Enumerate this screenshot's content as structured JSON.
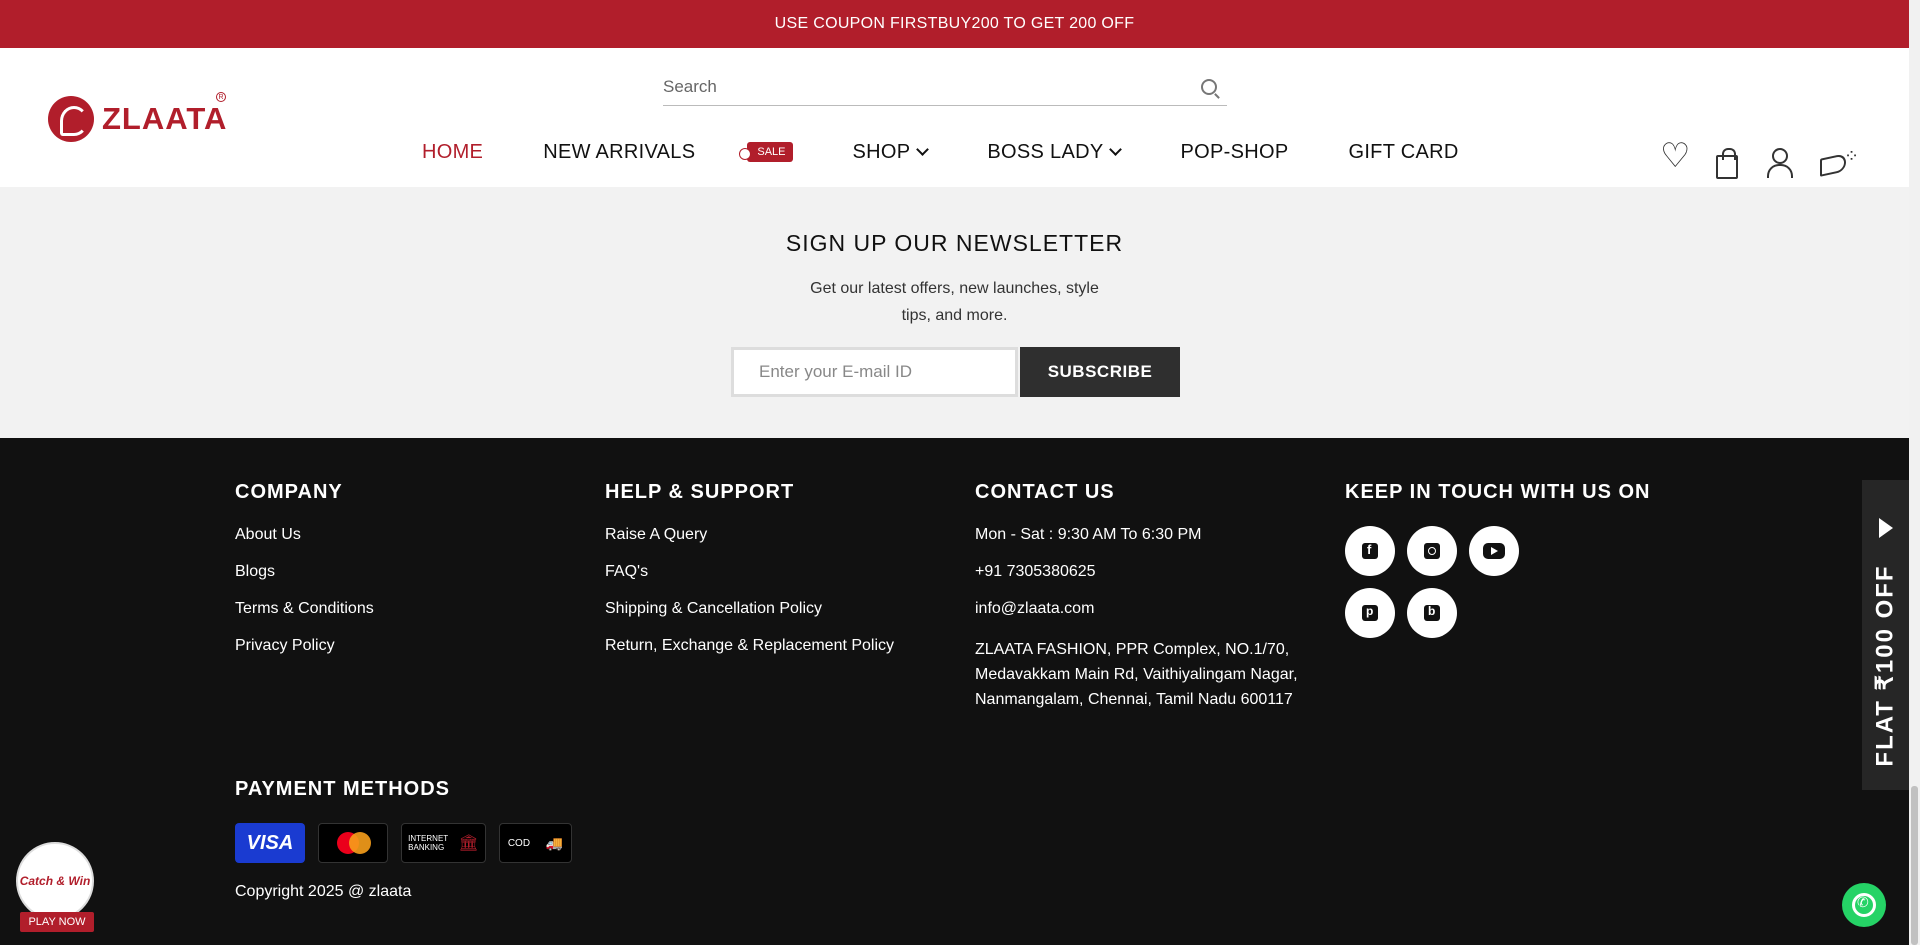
{
  "announcement": "USE COUPON FIRSTBUY200 TO GET 200 OFF",
  "brand": {
    "name": "ZLAATA",
    "color": "#b11e2b"
  },
  "search": {
    "placeholder": "Search"
  },
  "nav": {
    "items": [
      "HOME",
      "NEW ARRIVALS",
      "SHOP",
      "BOSS LADY",
      "POP-SHOP",
      "GIFT CARD"
    ],
    "sale_tag": "SALE",
    "active": "HOME"
  },
  "header_icons": [
    "heart-icon",
    "bag-icon",
    "user-icon",
    "megaphone-icon"
  ],
  "newsletter": {
    "title": "SIGN UP OUR NEWSLETTER",
    "subtitle": "Get our latest offers, new launches, style tips, and more.",
    "placeholder": "Enter your E-mail ID",
    "button": "SUBSCRIBE"
  },
  "footer": {
    "company": {
      "title": "COMPANY",
      "links": [
        "About Us",
        "Blogs",
        "Terms & Conditions",
        "Privacy Policy"
      ]
    },
    "help": {
      "title": "HELP & SUPPORT",
      "links": [
        "Raise A Query",
        "FAQ's",
        "Shipping & Cancellation Policy",
        "Return, Exchange & Replacement Policy"
      ]
    },
    "contact": {
      "title": "CONTACT US",
      "hours": "Mon - Sat : 9:30 AM To 6:30 PM",
      "phone": "+91 7305380625",
      "email": "info@zlaata.com",
      "address": "ZLAATA FASHION, PPR Complex, NO.1/70, Medavakkam Main Rd, Vaithiyalingam Nagar, Nanmangalam, Chennai, Tamil Nadu 600117"
    },
    "social": {
      "title": "KEEP IN TOUCH WITH US ON",
      "icons": [
        "facebook-icon",
        "instagram-icon",
        "youtube-icon",
        "pinterest-icon",
        "blogger-icon"
      ]
    },
    "payment": {
      "title": "PAYMENT METHODS",
      "visa": "VISA",
      "net_banking": "INTERNET BANKING",
      "cod": "COD"
    },
    "copyright": "Copyright 2025 @ zlaata"
  },
  "floating": {
    "flat_offer": "FLAT ₹100 OFF",
    "catch_win": "Catch & Win",
    "play_now": "PLAY NOW"
  }
}
